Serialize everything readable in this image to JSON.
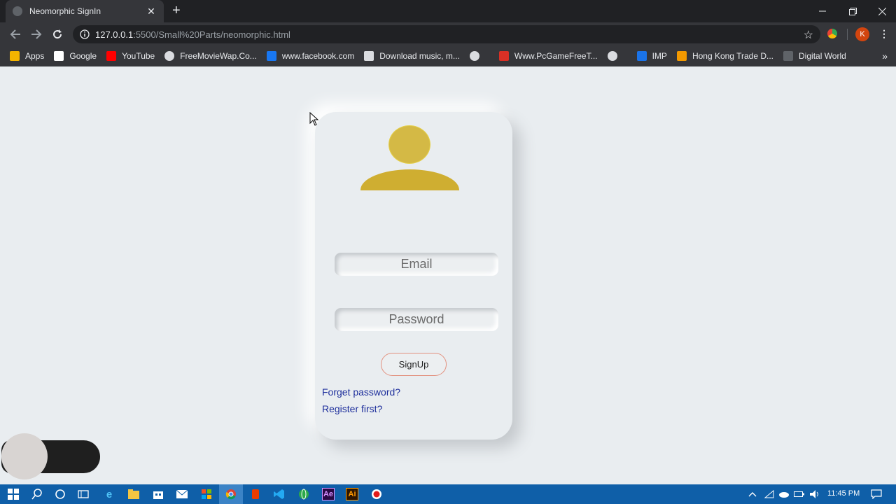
{
  "browser": {
    "tab_title": "Neomorphic SignIn",
    "url_host": "127.0.0.1",
    "url_path": ":5500/Small%20Parts/neomorphic.html",
    "profile_initial": "K"
  },
  "bookmarks": [
    {
      "label": "Apps",
      "icon": "apps-grid-icon",
      "color": "#f4b400"
    },
    {
      "label": "Google",
      "icon": "google-icon",
      "color": "#ffffff"
    },
    {
      "label": "YouTube",
      "icon": "youtube-icon",
      "color": "#ff0000"
    },
    {
      "label": "FreeMovieWap.Co...",
      "icon": "globe-icon",
      "color": "#dadce0"
    },
    {
      "label": "www.facebook.com",
      "icon": "facebook-icon",
      "color": "#1877f2"
    },
    {
      "label": "Download music, m...",
      "icon": "download-icon",
      "color": "#dadce0"
    },
    {
      "label": "",
      "icon": "globe-icon",
      "color": "#dadce0"
    },
    {
      "label": "Www.PcGameFreeT...",
      "icon": "pcgame-icon",
      "color": "#d93025"
    },
    {
      "label": "",
      "icon": "globe-icon",
      "color": "#dadce0"
    },
    {
      "label": "IMP",
      "icon": "imp-icon",
      "color": "#1a73e8"
    },
    {
      "label": "Hong Kong Trade D...",
      "icon": "chart-icon",
      "color": "#f29900"
    },
    {
      "label": "Digital World",
      "icon": "digital-world-icon",
      "color": "#5f6368"
    }
  ],
  "form": {
    "email_placeholder": "Email",
    "password_placeholder": "Password",
    "signup_label": "SignUp",
    "forget_label": "Forget password?",
    "register_label": "Register first?"
  },
  "taskbar": {
    "time": "11:45 PM"
  }
}
